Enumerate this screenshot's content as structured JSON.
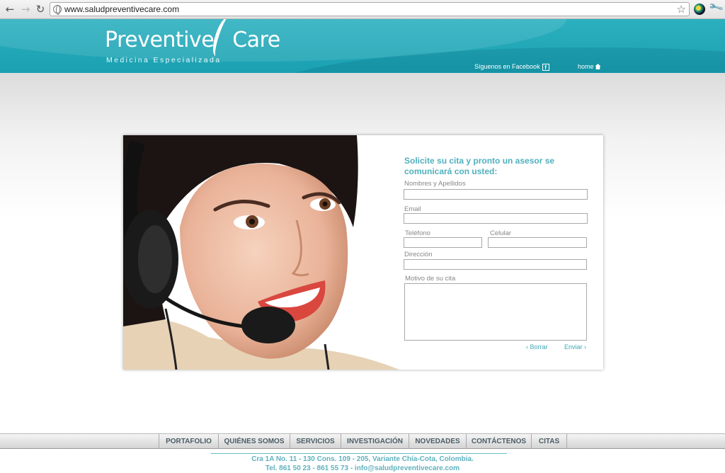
{
  "browser": {
    "url": "www.saludpreventivecare.com",
    "back_glyph": "←",
    "forward_glyph": "→",
    "reload_glyph": "↻",
    "star_glyph": "☆",
    "wrench_glyph": "🔧"
  },
  "header": {
    "logo_left": "Preventive",
    "logo_right": "Care",
    "logo_sub": "Medicina Especializada",
    "facebook_label": "Síguenos en Facebook",
    "facebook_icon": "f",
    "home_label": "home"
  },
  "form": {
    "title": "Solicite su cita y pronto un asesor se comunicará con usted:",
    "name_label": "Nombres y Apellidos",
    "email_label": "Email",
    "phone_label": "Teléfono",
    "mobile_label": "Celular",
    "address_label": "Dirección",
    "reason_label": "Motivo de su cita",
    "clear_label": "‹ Borrar",
    "send_label": "Enviar ›"
  },
  "nav": {
    "items": [
      "PORTAFOLIO",
      "QUIÉNES SOMOS",
      "SERVICIOS",
      "INVESTIGACIÓN",
      "NOVEDADES",
      "CONTÁCTENOS",
      "CITAS"
    ]
  },
  "footer": {
    "address": "Cra 1A No. 11 - 130 Cons. 109 - 205, Variante Chía-Cota, Colombia.",
    "contact": "Tel. 861 50 23 - 861 55 73 - info@saludpreventivecare.com"
  }
}
